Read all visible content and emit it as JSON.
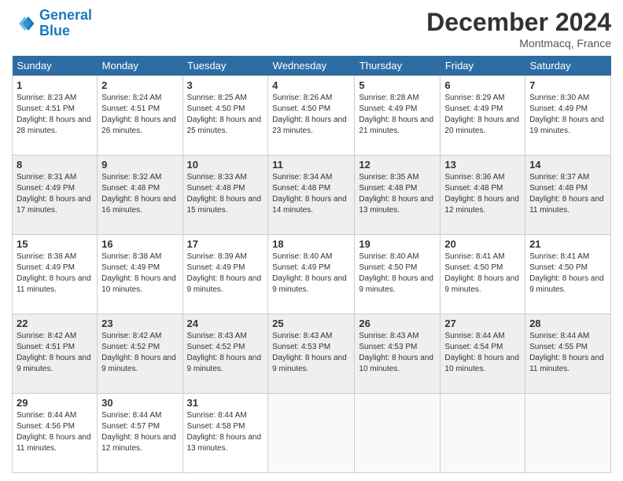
{
  "header": {
    "logo_line1": "General",
    "logo_line2": "Blue",
    "month_title": "December 2024",
    "location": "Montmacq, France"
  },
  "days_of_week": [
    "Sunday",
    "Monday",
    "Tuesday",
    "Wednesday",
    "Thursday",
    "Friday",
    "Saturday"
  ],
  "weeks": [
    [
      {
        "num": "1",
        "sunrise": "8:23 AM",
        "sunset": "4:51 PM",
        "daylight": "8 hours and 28 minutes."
      },
      {
        "num": "2",
        "sunrise": "8:24 AM",
        "sunset": "4:51 PM",
        "daylight": "8 hours and 26 minutes."
      },
      {
        "num": "3",
        "sunrise": "8:25 AM",
        "sunset": "4:50 PM",
        "daylight": "8 hours and 25 minutes."
      },
      {
        "num": "4",
        "sunrise": "8:26 AM",
        "sunset": "4:50 PM",
        "daylight": "8 hours and 23 minutes."
      },
      {
        "num": "5",
        "sunrise": "8:28 AM",
        "sunset": "4:49 PM",
        "daylight": "8 hours and 21 minutes."
      },
      {
        "num": "6",
        "sunrise": "8:29 AM",
        "sunset": "4:49 PM",
        "daylight": "8 hours and 20 minutes."
      },
      {
        "num": "7",
        "sunrise": "8:30 AM",
        "sunset": "4:49 PM",
        "daylight": "8 hours and 19 minutes."
      }
    ],
    [
      {
        "num": "8",
        "sunrise": "8:31 AM",
        "sunset": "4:49 PM",
        "daylight": "8 hours and 17 minutes."
      },
      {
        "num": "9",
        "sunrise": "8:32 AM",
        "sunset": "4:48 PM",
        "daylight": "8 hours and 16 minutes."
      },
      {
        "num": "10",
        "sunrise": "8:33 AM",
        "sunset": "4:48 PM",
        "daylight": "8 hours and 15 minutes."
      },
      {
        "num": "11",
        "sunrise": "8:34 AM",
        "sunset": "4:48 PM",
        "daylight": "8 hours and 14 minutes."
      },
      {
        "num": "12",
        "sunrise": "8:35 AM",
        "sunset": "4:48 PM",
        "daylight": "8 hours and 13 minutes."
      },
      {
        "num": "13",
        "sunrise": "8:36 AM",
        "sunset": "4:48 PM",
        "daylight": "8 hours and 12 minutes."
      },
      {
        "num": "14",
        "sunrise": "8:37 AM",
        "sunset": "4:48 PM",
        "daylight": "8 hours and 11 minutes."
      }
    ],
    [
      {
        "num": "15",
        "sunrise": "8:38 AM",
        "sunset": "4:49 PM",
        "daylight": "8 hours and 11 minutes."
      },
      {
        "num": "16",
        "sunrise": "8:38 AM",
        "sunset": "4:49 PM",
        "daylight": "8 hours and 10 minutes."
      },
      {
        "num": "17",
        "sunrise": "8:39 AM",
        "sunset": "4:49 PM",
        "daylight": "8 hours and 9 minutes."
      },
      {
        "num": "18",
        "sunrise": "8:40 AM",
        "sunset": "4:49 PM",
        "daylight": "8 hours and 9 minutes."
      },
      {
        "num": "19",
        "sunrise": "8:40 AM",
        "sunset": "4:50 PM",
        "daylight": "8 hours and 9 minutes."
      },
      {
        "num": "20",
        "sunrise": "8:41 AM",
        "sunset": "4:50 PM",
        "daylight": "8 hours and 9 minutes."
      },
      {
        "num": "21",
        "sunrise": "8:41 AM",
        "sunset": "4:50 PM",
        "daylight": "8 hours and 9 minutes."
      }
    ],
    [
      {
        "num": "22",
        "sunrise": "8:42 AM",
        "sunset": "4:51 PM",
        "daylight": "8 hours and 9 minutes."
      },
      {
        "num": "23",
        "sunrise": "8:42 AM",
        "sunset": "4:52 PM",
        "daylight": "8 hours and 9 minutes."
      },
      {
        "num": "24",
        "sunrise": "8:43 AM",
        "sunset": "4:52 PM",
        "daylight": "8 hours and 9 minutes."
      },
      {
        "num": "25",
        "sunrise": "8:43 AM",
        "sunset": "4:53 PM",
        "daylight": "8 hours and 9 minutes."
      },
      {
        "num": "26",
        "sunrise": "8:43 AM",
        "sunset": "4:53 PM",
        "daylight": "8 hours and 10 minutes."
      },
      {
        "num": "27",
        "sunrise": "8:44 AM",
        "sunset": "4:54 PM",
        "daylight": "8 hours and 10 minutes."
      },
      {
        "num": "28",
        "sunrise": "8:44 AM",
        "sunset": "4:55 PM",
        "daylight": "8 hours and 11 minutes."
      }
    ],
    [
      {
        "num": "29",
        "sunrise": "8:44 AM",
        "sunset": "4:56 PM",
        "daylight": "8 hours and 11 minutes."
      },
      {
        "num": "30",
        "sunrise": "8:44 AM",
        "sunset": "4:57 PM",
        "daylight": "8 hours and 12 minutes."
      },
      {
        "num": "31",
        "sunrise": "8:44 AM",
        "sunset": "4:58 PM",
        "daylight": "8 hours and 13 minutes."
      },
      null,
      null,
      null,
      null
    ]
  ]
}
